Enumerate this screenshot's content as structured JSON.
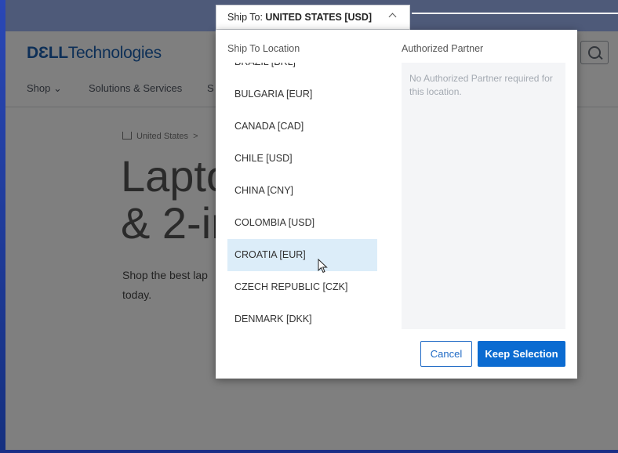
{
  "shipto_tab": {
    "prefix": "Ship To: ",
    "value": "UNITED STATES [USD]",
    "icon": "chevron-up-icon"
  },
  "header": {
    "logo_brand": "DƐLL",
    "logo_suffix": "Technologies",
    "nav": [
      {
        "label": "Shop ⌄"
      },
      {
        "label": "Solutions & Services"
      },
      {
        "label": "S"
      }
    ]
  },
  "page": {
    "breadcrumb": "United States",
    "breadcrumb_sep": ">",
    "hero_line1": "Lapto",
    "hero_line2": "& 2-ir",
    "sub_line1": "Shop the best lap",
    "sub_line2": "today."
  },
  "modal": {
    "location_label": "Ship To Location",
    "partner_label": "Authorized Partner",
    "partner_message": "No Authorized Partner required for this location.",
    "countries": [
      {
        "label": "BRAZIL [BRL]",
        "selected": false
      },
      {
        "label": "BULGARIA [EUR]",
        "selected": false
      },
      {
        "label": "CANADA [CAD]",
        "selected": false
      },
      {
        "label": "CHILE [USD]",
        "selected": false
      },
      {
        "label": "CHINA [CNY]",
        "selected": false
      },
      {
        "label": "COLOMBIA [USD]",
        "selected": false
      },
      {
        "label": "CROATIA [EUR]",
        "selected": true
      },
      {
        "label": "CZECH REPUBLIC [CZK]",
        "selected": false
      },
      {
        "label": "DENMARK [DKK]",
        "selected": false
      }
    ],
    "cancel_label": "Cancel",
    "keep_label": "Keep Selection"
  },
  "colors": {
    "accent": "#0b6bd1",
    "selected_row": "#dcedf9",
    "logo": "#1b5fae"
  }
}
